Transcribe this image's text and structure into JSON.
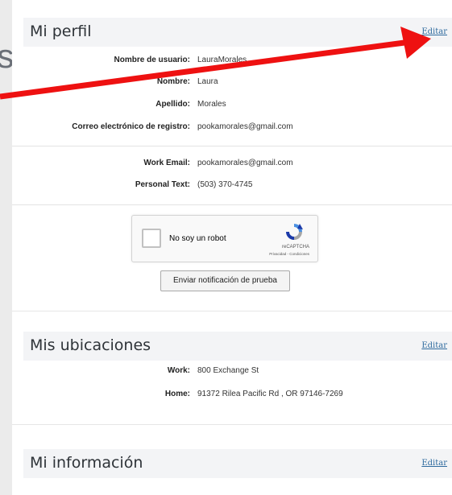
{
  "background_heading_fragment": "es",
  "profile": {
    "title": "Mi perfil",
    "edit": "Editar",
    "rows": [
      {
        "label": "Nombre de usuario:",
        "value": "LauraMorales"
      },
      {
        "label": "Nombre:",
        "value": "Laura"
      },
      {
        "label": "Apellido:",
        "value": "Morales"
      },
      {
        "label": "Correo electrónico de registro:",
        "value": "pookamorales@gmail.com"
      }
    ],
    "extra_rows": [
      {
        "label": "Work Email:",
        "value": "pookamorales@gmail.com"
      },
      {
        "label": "Personal Text:",
        "value": "(503) 370-4745"
      }
    ],
    "recaptcha": {
      "label": "No soy un robot",
      "brand": "reCAPTCHA",
      "terms": "Privacidad - Condiciones"
    },
    "test_button": "Enviar notificación de prueba"
  },
  "locations": {
    "title": "Mis ubicaciones",
    "edit": "Editar",
    "rows": [
      {
        "label": "Work:",
        "value": "800 Exchange St"
      },
      {
        "label": "Home:",
        "value": "91372 Rilea Pacific Rd , OR 97146-7269"
      }
    ]
  },
  "info": {
    "title": "Mi información",
    "edit": "Editar"
  },
  "colors": {
    "arrow": "#ee1111",
    "link": "#2e6a9e",
    "header_bg": "#f3f4f6"
  }
}
